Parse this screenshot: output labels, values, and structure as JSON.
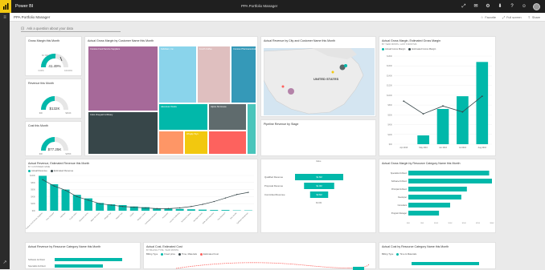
{
  "app": {
    "name": "Power BI",
    "window_title": "PPA Portfolio Manager"
  },
  "subbar": {
    "title": "PPA Portfolio Manager",
    "actions": [
      "Favorite",
      "Full screen",
      "Share"
    ]
  },
  "qa": {
    "placeholder": "Ask a question about your data"
  },
  "colors": {
    "teal": "#01b8aa",
    "dark": "#374649",
    "topbar": "#1f1f1f",
    "brand": "#f2c811"
  },
  "tiles": {
    "gm": {
      "title": "Gross Margin this Month",
      "value_label": "41.49%",
      "min": "0.00%",
      "max": "100.00%",
      "target": "60.74%"
    },
    "rev": {
      "title": "Revenue this Month",
      "value_label": "$132K",
      "min": "$0K",
      "max": "$264K"
    },
    "cost": {
      "title": "Cost this Month",
      "value_label": "$77.25K",
      "min": "$0K",
      "max": "$155K"
    },
    "treemap": {
      "title": "Actual Gross Margin by Customer Name this Month",
      "cells": [
        "Contoso Food Service Suppliers",
        "Coho Vineyard & Winery",
        "Fabrikam, Inc.",
        "Fourth Coffee",
        "Contoso Pharmaceuticals",
        "Adventure Works",
        "Alpine Ski House",
        "Wingtip Toys"
      ]
    },
    "map": {
      "title": "Actual Revenue by City and Customer Name this Month",
      "country": "UNITED STATES"
    },
    "gm_est": {
      "title": "Actual Gross Margin, Estimated Gross Margin",
      "subtitle": "BY YEAR MONTH, LAST 6 MONTHS",
      "legend": [
        "Actual Gross Margin",
        "Estimated Gross Margin"
      ],
      "x": [
        "Apr 2016",
        "May 2016",
        "Jun 2016",
        "Jul 2016",
        "Aug 2016"
      ],
      "y_ticks": [
        "$0K",
        "$20K",
        "$40K",
        "$60K",
        "$80K",
        "$100K",
        "$120K",
        "$140K",
        "$160K",
        "$180K"
      ]
    },
    "pipeline": {
      "title": "Pipeline Revenue by Stage",
      "header": "Value",
      "stages": [
        "Qualified Revenue",
        "Proposal Revenue",
        "Committed Revenue"
      ],
      "values": [
        "$1.6M",
        "$1.0M",
        "$0.6M"
      ],
      "footer": "$3.0M"
    },
    "rev_est": {
      "title": "Actual Revenue, Estimated Revenue this Month",
      "subtitle": "BY CUSTOMER NAME",
      "legend": [
        "Actual Revenue",
        "Estimated Revenue"
      ],
      "y_ticks": [
        "$0K",
        "$20K",
        "$40K",
        "$60K",
        "$80K",
        "$100K"
      ],
      "categories": [
        "Contoso Food Service Suppliers",
        "Coho Vineyard",
        "Fabrikam",
        "Fourth Coffee",
        "Adventure Works",
        "Alpine Ski House",
        "Wingtip Toys",
        "Tailspin Toys",
        "Litware",
        "Margie's Travel",
        "Humongous Insurance",
        "Proseware",
        "Lucerne Publishing",
        "Northwind Traders",
        "Woodgrove Bank",
        "Wide World Importers",
        "Trey Research",
        "Blue Yonder",
        "Fabrikam Residences"
      ]
    },
    "gm_cat": {
      "title": "Actual Gross Margin by Resource Category Name this Month",
      "categories": [
        "Specialist Architect",
        "Software Architect",
        "Principal Architect",
        "Developer",
        "Consultant",
        "Program Manager"
      ],
      "x_ticks": [
        "$0K",
        "$5K",
        "$10K",
        "$15K",
        "$20K",
        "$25K",
        "$30K"
      ]
    },
    "rev_cat": {
      "title": "Actual Revenue by Resource Category Name this Month",
      "categories": [
        "Software Architect",
        "Specialist Architect"
      ]
    },
    "cost_est": {
      "title": "Actual Cost, Estimated Cost",
      "subtitle": "BY BILLING TYPE, YEAR MONTH",
      "legend_label": "Billing Type",
      "legend": [
        "Fixed price",
        "Time, Materials",
        "Estimated Cost"
      ]
    },
    "cost_cat": {
      "title": "Actual Cost by Resource Category Name this Month",
      "legend_label": "Billing Type",
      "legend": [
        "Time & Materials"
      ]
    }
  },
  "chart_data": [
    {
      "type": "bar",
      "title": "Actual Gross Margin, Estimated Gross Margin",
      "subtitle": "BY YEAR MONTH, LAST 6 MONTHS",
      "categories": [
        "Apr 2016",
        "May 2016",
        "Jun 2016",
        "Jul 2016",
        "Aug 2016"
      ],
      "series": [
        {
          "name": "Actual Gross Margin",
          "values": [
            0,
            18,
            72,
            98,
            168
          ]
        },
        {
          "name": "Estimated Gross Margin",
          "values": [
            88,
            62,
            78,
            66,
            98
          ]
        }
      ],
      "ylim": [
        0,
        180
      ]
    },
    {
      "type": "bar",
      "title": "Actual Revenue, Estimated Revenue this Month",
      "subtitle": "BY CUSTOMER NAME",
      "categories": [
        "Contoso Food Service Suppliers",
        "Coho Vineyard",
        "Fabrikam",
        "Fourth Coffee",
        "Adventure Works",
        "Alpine Ski House",
        "Wingtip Toys",
        "Tailspin Toys",
        "Litware",
        "Margie's Travel",
        "Humongous Insurance",
        "Proseware",
        "Lucerne Publishing",
        "Northwind Traders",
        "Woodgrove Bank",
        "Wide World Importers",
        "Trey Research",
        "Blue Yonder",
        "Fabrikam Residences"
      ],
      "series": [
        {
          "name": "Actual Revenue",
          "values": [
            99,
            75,
            60,
            45,
            35,
            22,
            18,
            16,
            12,
            10,
            7,
            6,
            5,
            4,
            3,
            2,
            2,
            1,
            1
          ]
        },
        {
          "name": "Estimated Revenue",
          "values": [
            88,
            70,
            58,
            40,
            30,
            20,
            16,
            12,
            10,
            8,
            6,
            6,
            8,
            12,
            18,
            26,
            36,
            46,
            52
          ]
        }
      ],
      "ylim": [
        0,
        100
      ]
    },
    {
      "type": "bar",
      "title": "Actual Gross Margin by Resource Category Name this Month",
      "categories": [
        "Specialist Architect",
        "Software Architect",
        "Principal Architect",
        "Developer",
        "Consultant",
        "Program Manager"
      ],
      "values": [
        29,
        30,
        21,
        19,
        15,
        11
      ],
      "xlim": [
        0,
        30
      ]
    }
  ]
}
